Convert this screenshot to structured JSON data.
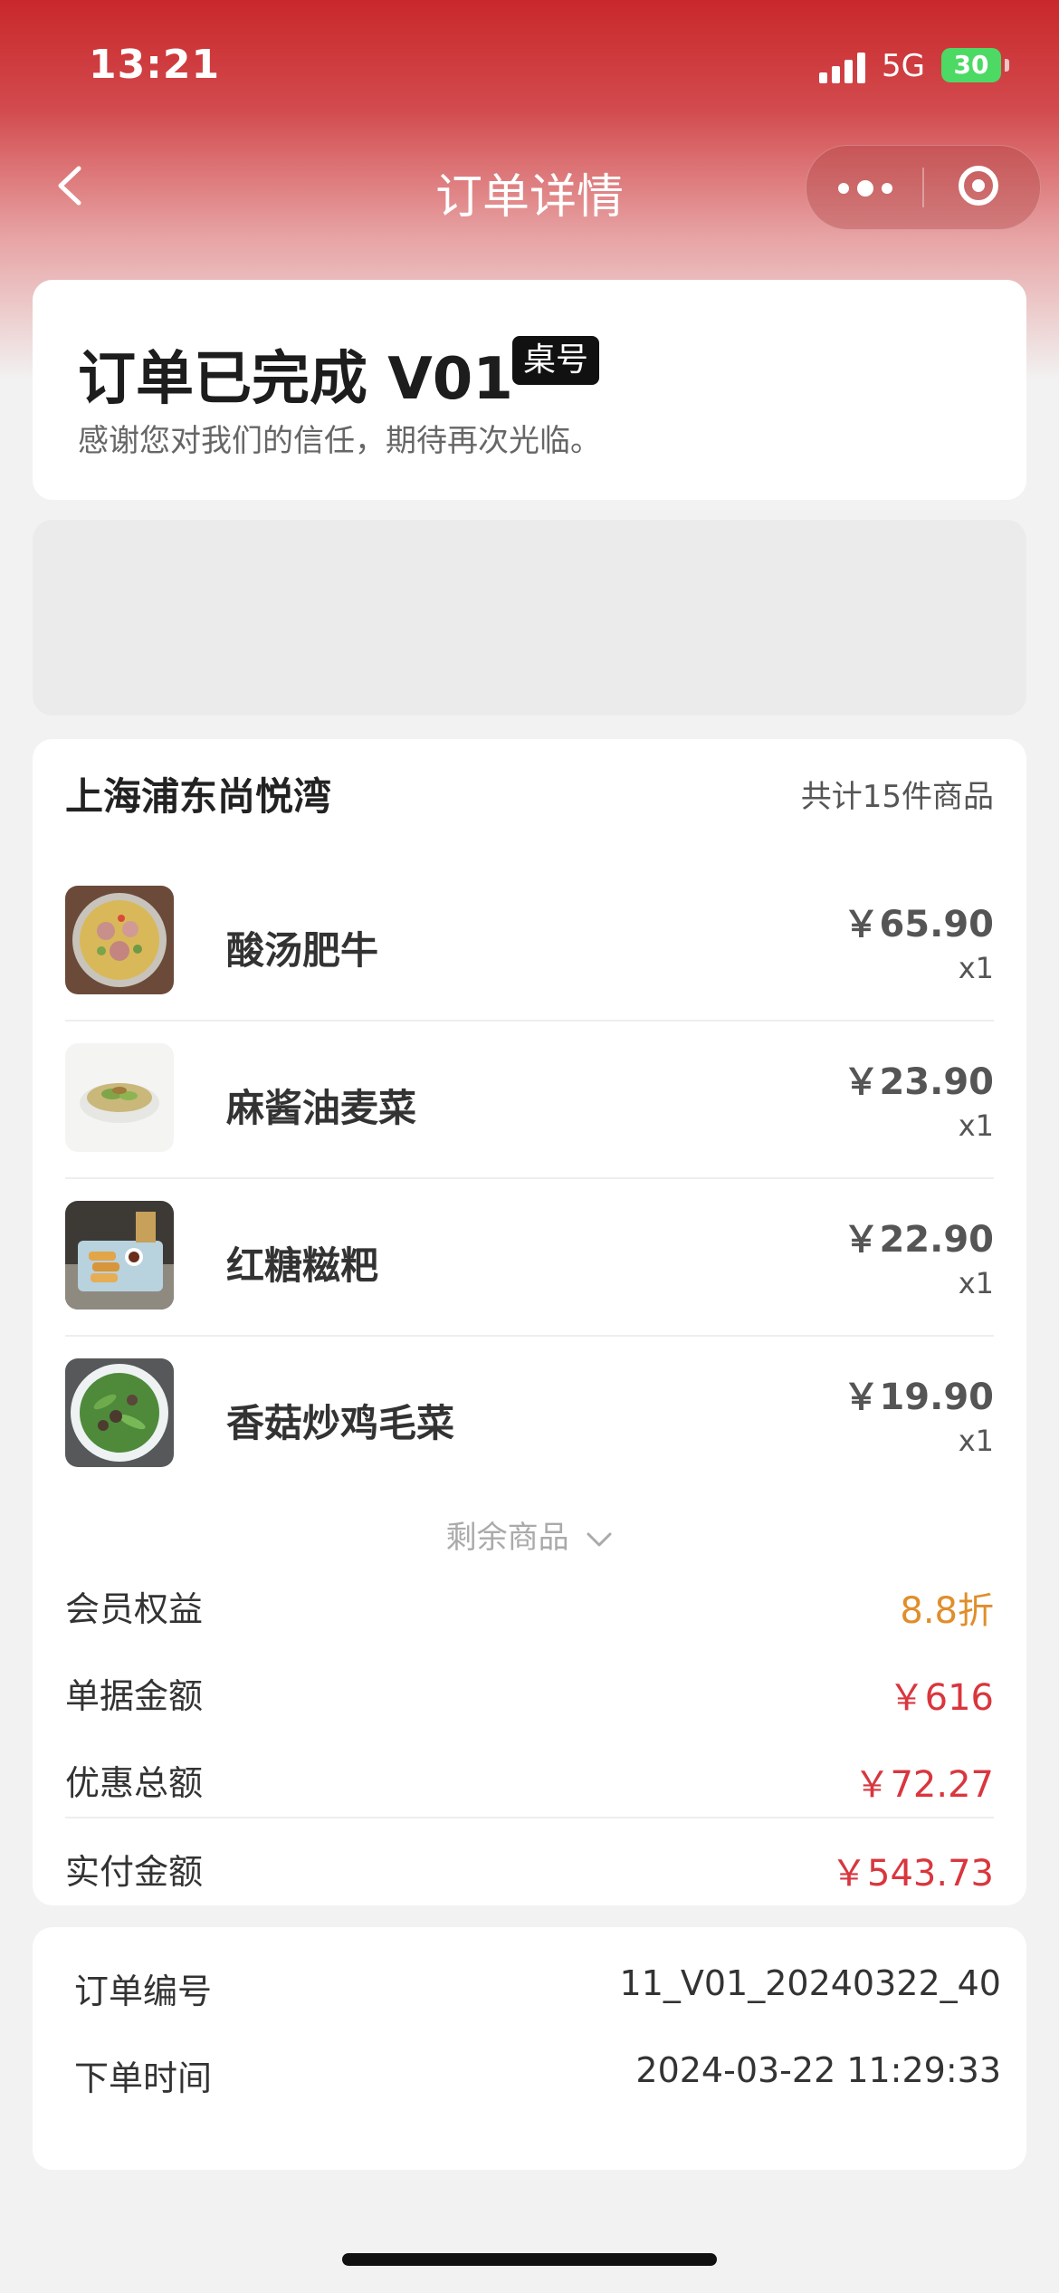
{
  "status_bar": {
    "time": "13:21",
    "network": "5G",
    "battery": "30"
  },
  "nav": {
    "title": "订单详情",
    "back_icon": "chevron-left-icon",
    "more_icon": "more-dots-icon",
    "target_icon": "target-icon"
  },
  "order_status": {
    "title": "订单已完成 V01",
    "table_badge": "桌号",
    "subtitle": "感谢您对我们的信任，期待再次光临。"
  },
  "store": {
    "name": "上海浦东尚悦湾",
    "total_count": "共计15件商品"
  },
  "items": [
    {
      "name": "酸汤肥牛",
      "price": "￥65.90",
      "qty": "x1"
    },
    {
      "name": "麻酱油麦菜",
      "price": "￥23.90",
      "qty": "x1"
    },
    {
      "name": "红糖糍粑",
      "price": "￥22.90",
      "qty": "x1"
    },
    {
      "name": "香菇炒鸡毛菜",
      "price": "￥19.90",
      "qty": "x1"
    }
  ],
  "more_items": "剩余商品",
  "summary": {
    "member": {
      "label": "会员权益",
      "value": "8.8折"
    },
    "bill": {
      "label": "单据金额",
      "value": "￥616"
    },
    "discount": {
      "label": "优惠总额",
      "value": "￥72.27"
    },
    "paid": {
      "label": "实付金额",
      "value": "￥543.73"
    }
  },
  "info": {
    "order_no": {
      "label": "订单编号",
      "value": "11_V01_20240322_40"
    },
    "order_time": {
      "label": "下单时间",
      "value": "2024-03-22 11:29:33"
    }
  },
  "colors": {
    "brand_red": "#c9282b",
    "price_red": "#d9363e",
    "discount_orange": "#e08e2b",
    "battery_green": "#4cd964"
  }
}
